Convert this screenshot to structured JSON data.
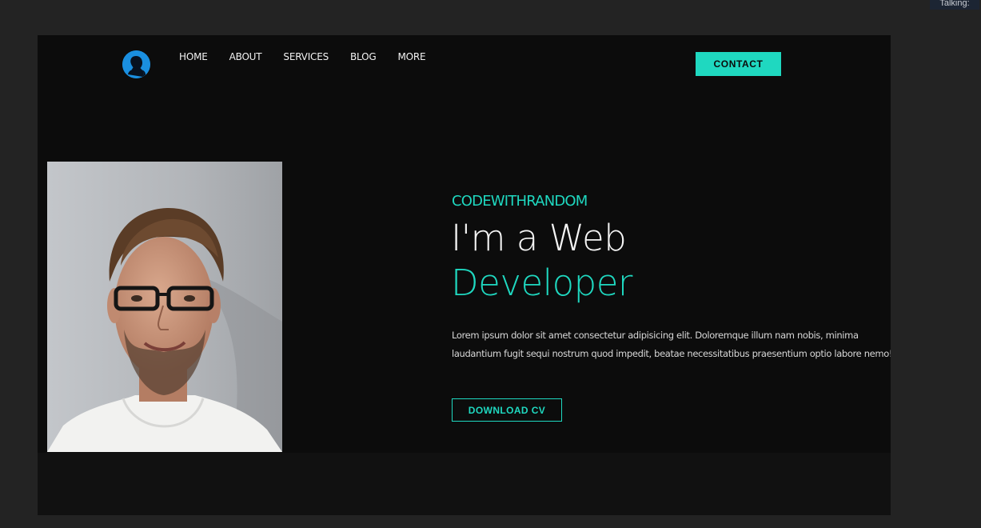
{
  "corner_label": "Talking:",
  "nav": {
    "links": [
      "HOME",
      "ABOUT",
      "SERVICES",
      "BLOG",
      "MORE"
    ],
    "contact_label": "CONTACT"
  },
  "hero": {
    "kicker": "CODEWITHRANDOM",
    "headline_line1": "I'm a Web",
    "headline_line2": "Developer",
    "intro": "Lorem ipsum dolor sit amet consectetur adipisicing elit. Doloremque illum nam nobis, minima laudantium fugit sequi nostrum quod impedit, beatae necessitatibus praesentium optio labore nemo!",
    "cta_label": "DOWNLOAD CV"
  },
  "colors": {
    "accent": "#1fd8c0",
    "page_background": "#232323",
    "frame_background": "#0c0c0c",
    "logo_blue": "#1a8fe0"
  },
  "icons": {
    "logo": "user-silhouette-icon"
  }
}
